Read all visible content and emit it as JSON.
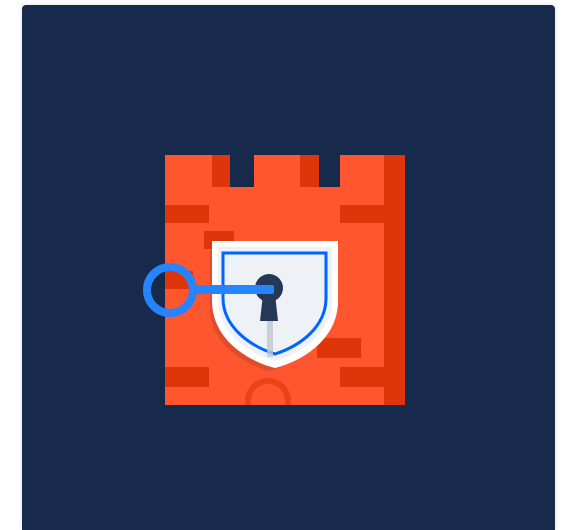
{
  "illustration": {
    "subject": "castle-tower-with-lock-and-key",
    "icon": "security-lock-icon",
    "colors": {
      "background": "#182a4b",
      "tower_main": "#ff5630",
      "tower_shade": "#de350b",
      "brick": "#de350b",
      "shield_fill": "#eef1f6",
      "shield_edge": "#ffffff",
      "shield_outline": "#0065ff",
      "keyhole": "#253858",
      "key": "#2684ff",
      "key_ring": "#2684ff"
    }
  }
}
